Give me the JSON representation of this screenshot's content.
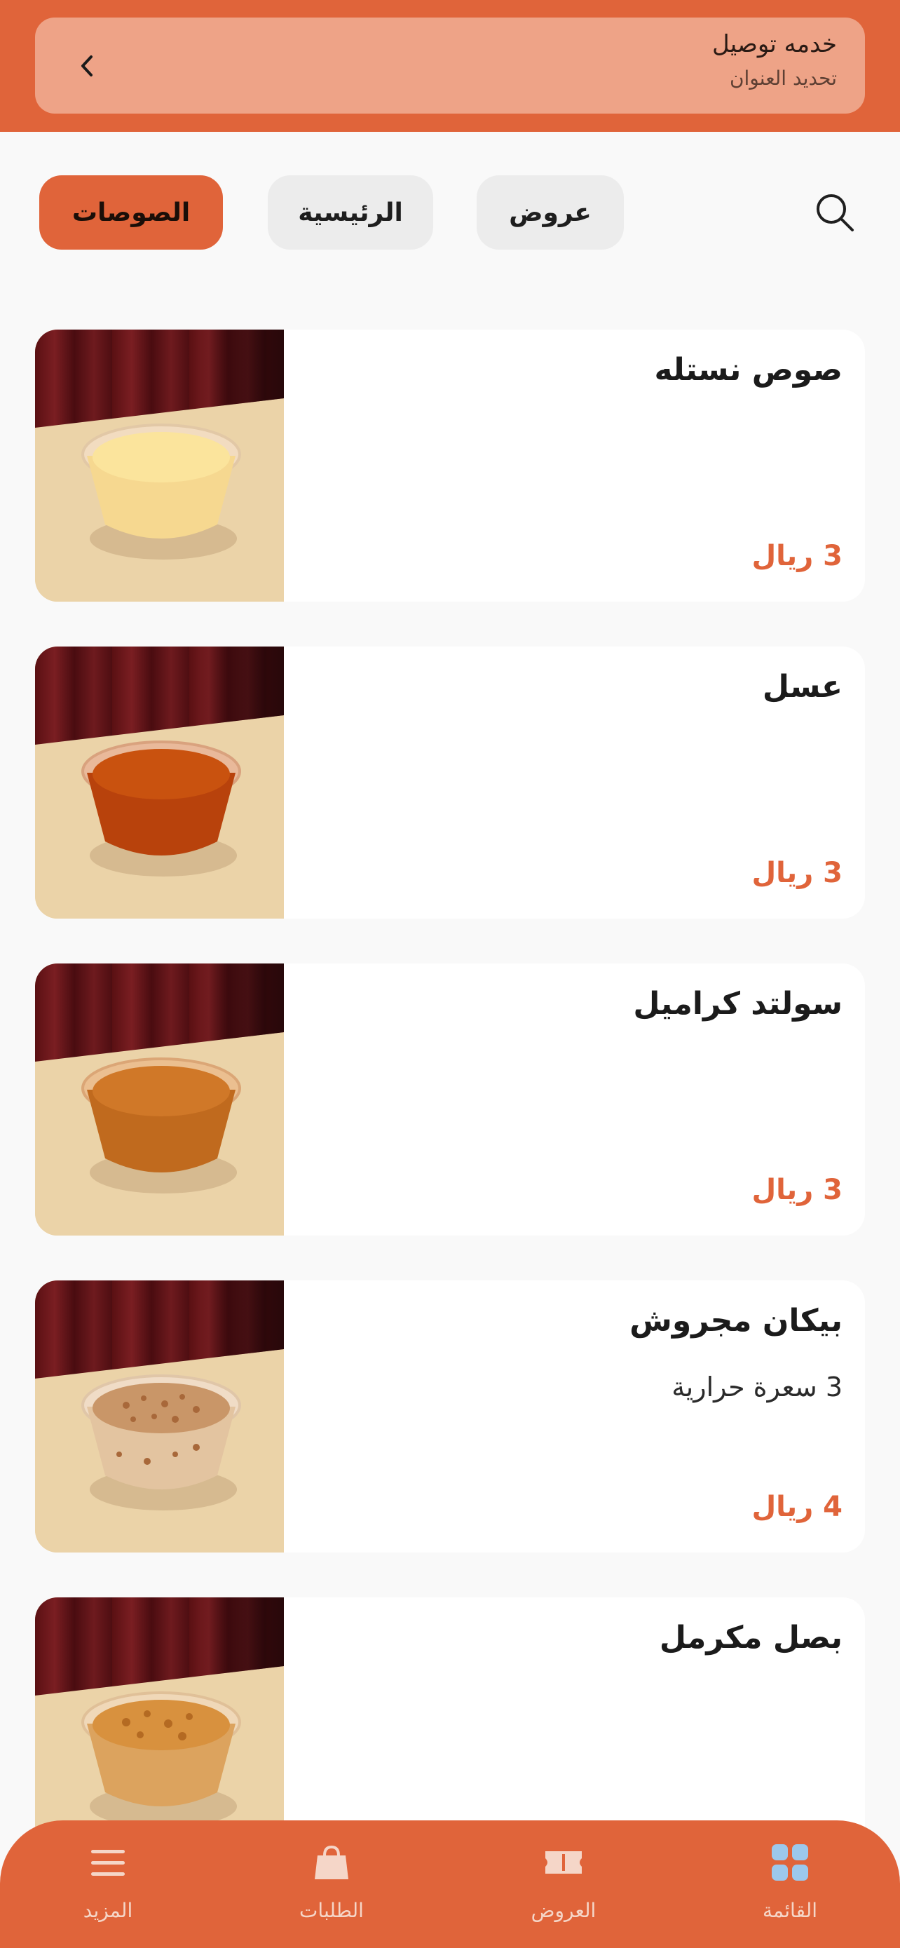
{
  "header": {
    "title": "خدمه توصيل",
    "subtitle": "تحديد العنوان"
  },
  "categories": {
    "chips": [
      {
        "label": "الصوصات",
        "active": true
      },
      {
        "label": "الرئيسية",
        "active": false
      },
      {
        "label": "عروض",
        "active": false
      }
    ]
  },
  "products": [
    {
      "name": "صوص نستله",
      "description": "",
      "price": "3 ريال",
      "icon": "sauce-cup-image"
    },
    {
      "name": "عسل",
      "description": "",
      "price": "3 ريال",
      "icon": "honey-cup-image"
    },
    {
      "name": "سولتد كراميل",
      "description": "",
      "price": "3 ريال",
      "icon": "caramel-cup-image"
    },
    {
      "name": "بيكان مجروش",
      "description": "3 سعرة حرارية",
      "price": "4 ريال",
      "icon": "pecan-cup-image"
    },
    {
      "name": "بصل مكرمل",
      "description": "",
      "price": "",
      "icon": "onion-cup-image"
    }
  ],
  "bottom_nav": {
    "items": [
      {
        "label": "المزيد",
        "icon": "menu-icon"
      },
      {
        "label": "الطلبات",
        "icon": "bag-icon"
      },
      {
        "label": "العروض",
        "icon": "ticket-icon"
      },
      {
        "label": "القائمة",
        "icon": "grid-icon"
      }
    ]
  },
  "colors": {
    "accent": "#e0643a",
    "header_box": "#eea387",
    "grid_icon": "#9cc8ec"
  }
}
